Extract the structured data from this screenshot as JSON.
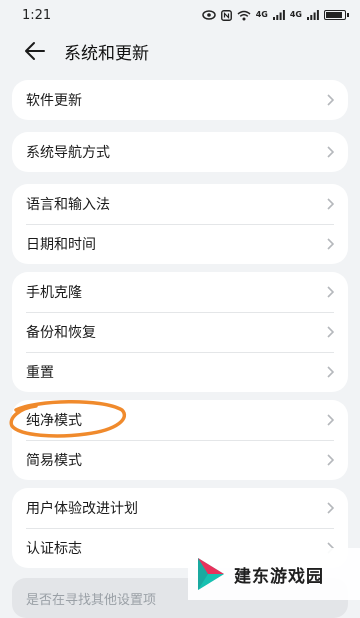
{
  "status_bar": {
    "time": "1:21",
    "net_badge_1": "4G",
    "net_badge_2": "4G"
  },
  "header": {
    "title": "系统和更新"
  },
  "groups": [
    {
      "items": [
        {
          "label": "软件更新"
        }
      ]
    },
    {
      "items": [
        {
          "label": "系统导航方式"
        }
      ]
    },
    {
      "items": [
        {
          "label": "语言和输入法"
        },
        {
          "label": "日期和时间"
        }
      ]
    },
    {
      "items": [
        {
          "label": "手机克隆"
        },
        {
          "label": "备份和恢复"
        },
        {
          "label": "重置"
        }
      ]
    },
    {
      "items": [
        {
          "label": "纯净模式"
        },
        {
          "label": "简易模式"
        }
      ]
    },
    {
      "items": [
        {
          "label": "用户体验改进计划"
        },
        {
          "label": "认证标志"
        }
      ]
    }
  ],
  "hint": "是否在寻找其他设置项",
  "watermark": {
    "text": "建东游戏园"
  },
  "colors": {
    "annotation": "#f08a2c",
    "background": "#f1f3f5",
    "card": "#ffffff"
  },
  "icons": [
    "eye-icon",
    "nfc-icon",
    "wifi-icon",
    "signal-icon",
    "battery-icon",
    "back-arrow-icon",
    "chevron-right-icon"
  ]
}
